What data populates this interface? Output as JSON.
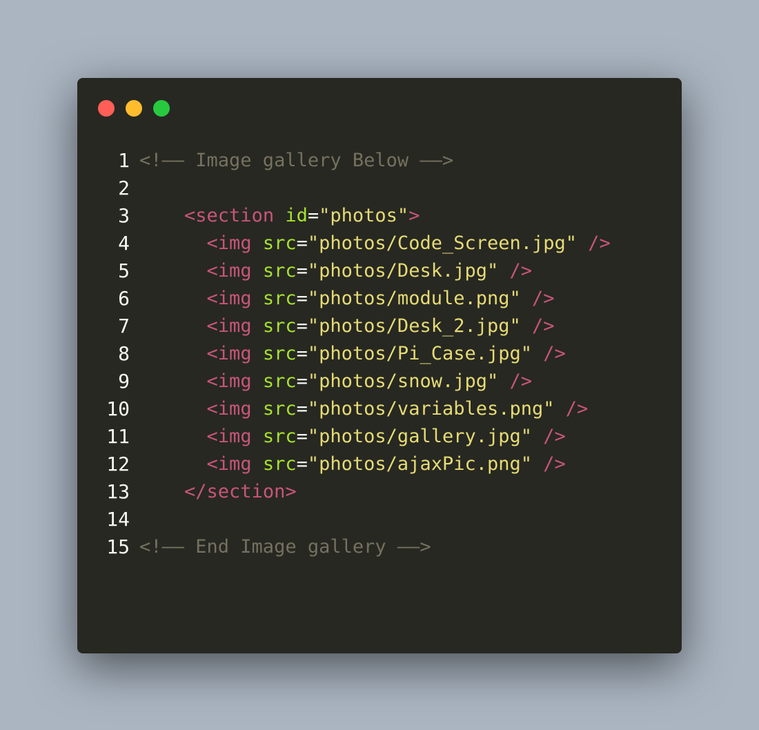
{
  "window": {
    "controls": [
      {
        "name": "close",
        "color": "#ff5f56"
      },
      {
        "name": "minimize",
        "color": "#ffbd2e"
      },
      {
        "name": "maximize",
        "color": "#27c93f"
      }
    ]
  },
  "code": {
    "lines": [
      {
        "num": "1",
        "tokens": [
          {
            "type": "comment",
            "text": "<!—— Image gallery Below ——>"
          }
        ]
      },
      {
        "num": "2",
        "tokens": []
      },
      {
        "num": "3",
        "tokens": [
          {
            "type": "plain",
            "text": "    "
          },
          {
            "type": "tagname",
            "text": "<section"
          },
          {
            "type": "plain",
            "text": " "
          },
          {
            "type": "attr",
            "text": "id"
          },
          {
            "type": "plain",
            "text": "="
          },
          {
            "type": "str",
            "text": "\"photos\""
          },
          {
            "type": "tagname",
            "text": ">"
          }
        ]
      },
      {
        "num": "4",
        "tokens": [
          {
            "type": "plain",
            "text": "      "
          },
          {
            "type": "tagname",
            "text": "<img"
          },
          {
            "type": "plain",
            "text": " "
          },
          {
            "type": "attr",
            "text": "src"
          },
          {
            "type": "plain",
            "text": "="
          },
          {
            "type": "str",
            "text": "\"photos/Code_Screen.jpg\""
          },
          {
            "type": "plain",
            "text": " "
          },
          {
            "type": "tagname",
            "text": "/>"
          }
        ]
      },
      {
        "num": "5",
        "tokens": [
          {
            "type": "plain",
            "text": "      "
          },
          {
            "type": "tagname",
            "text": "<img"
          },
          {
            "type": "plain",
            "text": " "
          },
          {
            "type": "attr",
            "text": "src"
          },
          {
            "type": "plain",
            "text": "="
          },
          {
            "type": "str",
            "text": "\"photos/Desk.jpg\""
          },
          {
            "type": "plain",
            "text": " "
          },
          {
            "type": "tagname",
            "text": "/>"
          }
        ]
      },
      {
        "num": "6",
        "tokens": [
          {
            "type": "plain",
            "text": "      "
          },
          {
            "type": "tagname",
            "text": "<img"
          },
          {
            "type": "plain",
            "text": " "
          },
          {
            "type": "attr",
            "text": "src"
          },
          {
            "type": "plain",
            "text": "="
          },
          {
            "type": "str",
            "text": "\"photos/module.png\""
          },
          {
            "type": "plain",
            "text": " "
          },
          {
            "type": "tagname",
            "text": "/>"
          }
        ]
      },
      {
        "num": "7",
        "tokens": [
          {
            "type": "plain",
            "text": "      "
          },
          {
            "type": "tagname",
            "text": "<img"
          },
          {
            "type": "plain",
            "text": " "
          },
          {
            "type": "attr",
            "text": "src"
          },
          {
            "type": "plain",
            "text": "="
          },
          {
            "type": "str",
            "text": "\"photos/Desk_2.jpg\""
          },
          {
            "type": "plain",
            "text": " "
          },
          {
            "type": "tagname",
            "text": "/>"
          }
        ]
      },
      {
        "num": "8",
        "tokens": [
          {
            "type": "plain",
            "text": "      "
          },
          {
            "type": "tagname",
            "text": "<img"
          },
          {
            "type": "plain",
            "text": " "
          },
          {
            "type": "attr",
            "text": "src"
          },
          {
            "type": "plain",
            "text": "="
          },
          {
            "type": "str",
            "text": "\"photos/Pi_Case.jpg\""
          },
          {
            "type": "plain",
            "text": " "
          },
          {
            "type": "tagname",
            "text": "/>"
          }
        ]
      },
      {
        "num": "9",
        "tokens": [
          {
            "type": "plain",
            "text": "      "
          },
          {
            "type": "tagname",
            "text": "<img"
          },
          {
            "type": "plain",
            "text": " "
          },
          {
            "type": "attr",
            "text": "src"
          },
          {
            "type": "plain",
            "text": "="
          },
          {
            "type": "str",
            "text": "\"photos/snow.jpg\""
          },
          {
            "type": "plain",
            "text": " "
          },
          {
            "type": "tagname",
            "text": "/>"
          }
        ]
      },
      {
        "num": "10",
        "tokens": [
          {
            "type": "plain",
            "text": "      "
          },
          {
            "type": "tagname",
            "text": "<img"
          },
          {
            "type": "plain",
            "text": " "
          },
          {
            "type": "attr",
            "text": "src"
          },
          {
            "type": "plain",
            "text": "="
          },
          {
            "type": "str",
            "text": "\"photos/variables.png\""
          },
          {
            "type": "plain",
            "text": " "
          },
          {
            "type": "tagname",
            "text": "/>"
          }
        ]
      },
      {
        "num": "11",
        "tokens": [
          {
            "type": "plain",
            "text": "      "
          },
          {
            "type": "tagname",
            "text": "<img"
          },
          {
            "type": "plain",
            "text": " "
          },
          {
            "type": "attr",
            "text": "src"
          },
          {
            "type": "plain",
            "text": "="
          },
          {
            "type": "str",
            "text": "\"photos/gallery.jpg\""
          },
          {
            "type": "plain",
            "text": " "
          },
          {
            "type": "tagname",
            "text": "/>"
          }
        ]
      },
      {
        "num": "12",
        "tokens": [
          {
            "type": "plain",
            "text": "      "
          },
          {
            "type": "tagname",
            "text": "<img"
          },
          {
            "type": "plain",
            "text": " "
          },
          {
            "type": "attr",
            "text": "src"
          },
          {
            "type": "plain",
            "text": "="
          },
          {
            "type": "str",
            "text": "\"photos/ajaxPic.png\""
          },
          {
            "type": "plain",
            "text": " "
          },
          {
            "type": "tagname",
            "text": "/>"
          }
        ]
      },
      {
        "num": "13",
        "tokens": [
          {
            "type": "plain",
            "text": "    "
          },
          {
            "type": "tagname",
            "text": "</section>"
          }
        ]
      },
      {
        "num": "14",
        "tokens": []
      },
      {
        "num": "15",
        "tokens": [
          {
            "type": "comment",
            "text": "<!—— End Image gallery ——>"
          }
        ]
      }
    ]
  }
}
